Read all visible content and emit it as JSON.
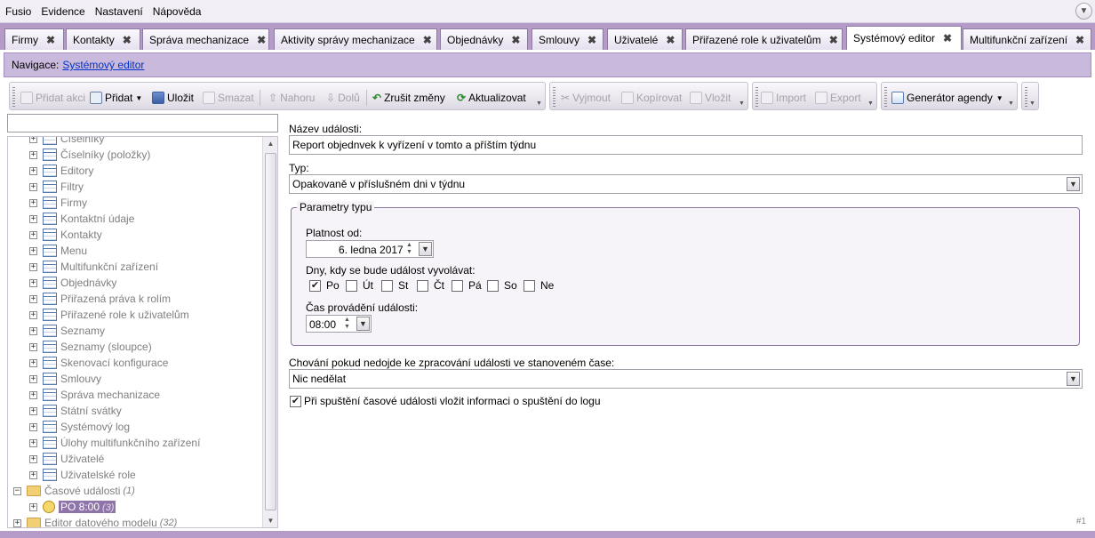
{
  "menu": [
    "Fusio",
    "Evidence",
    "Nastavení",
    "Nápověda"
  ],
  "tabs": [
    {
      "label": "Firmy",
      "active": false
    },
    {
      "label": "Kontakty",
      "active": false
    },
    {
      "label": "Správa mechanizace",
      "active": false
    },
    {
      "label": "Aktivity správy mechanizace",
      "active": false
    },
    {
      "label": "Objednávky",
      "active": false
    },
    {
      "label": "Smlouvy",
      "active": false
    },
    {
      "label": "Uživatelé",
      "active": false
    },
    {
      "label": "Přiřazené role k uživatelům",
      "active": false
    },
    {
      "label": "Systémový editor",
      "active": true
    },
    {
      "label": "Multifunkční zařízení",
      "active": false
    }
  ],
  "tab_close": "✖",
  "navigation": {
    "label": "Navigace:",
    "link": "Systémový editor"
  },
  "toolbar": {
    "add_action": "Přidat akci",
    "add": "Přidat",
    "save": "Uložit",
    "delete": "Smazat",
    "up": "Nahoru",
    "down": "Dolů",
    "cancel_changes": "Zrušit změny",
    "refresh": "Aktualizovat",
    "cut": "Vyjmout",
    "copy": "Kopírovat",
    "paste": "Vložit",
    "import": "Import",
    "export": "Export",
    "agenda_generator": "Generátor agendy"
  },
  "tree": {
    "items": [
      {
        "label": "Číselníky",
        "partial": true
      },
      {
        "label": "Číselníky (položky)"
      },
      {
        "label": "Editory"
      },
      {
        "label": "Filtry"
      },
      {
        "label": "Firmy"
      },
      {
        "label": "Kontaktní údaje"
      },
      {
        "label": "Kontakty"
      },
      {
        "label": "Menu"
      },
      {
        "label": "Multifunkční zařízení"
      },
      {
        "label": "Objednávky"
      },
      {
        "label": "Přiřazená práva k rolím"
      },
      {
        "label": "Přiřazené role k uživatelům"
      },
      {
        "label": "Seznamy"
      },
      {
        "label": "Seznamy (sloupce)"
      },
      {
        "label": "Skenovací konfigurace"
      },
      {
        "label": "Smlouvy"
      },
      {
        "label": "Správa mechanizace"
      },
      {
        "label": "Státní svátky"
      },
      {
        "label": "Systémový log"
      },
      {
        "label": "Úlohy multifunkčního zařízení"
      },
      {
        "label": "Uživatelé"
      },
      {
        "label": "Uživatelské role"
      }
    ],
    "events_folder": {
      "label": "Časové události",
      "count": "(1)"
    },
    "event_item": {
      "label": "PO 8:00",
      "count": "(3)"
    },
    "model_folder": {
      "label": "Editor datového modelu",
      "count": "(32)"
    }
  },
  "form": {
    "event_name_label": "Název události:",
    "event_name_value": "Report objednvek k vyřízení v tomto a příštím týdnu",
    "type_label": "Typ:",
    "type_value": "Opakovaně v příslušném dni v týdnu",
    "params_title": "Parametry typu",
    "valid_from_label": "Platnost od:",
    "valid_from_value": "6. ledna 2017",
    "days_label": "Dny, kdy se bude událost vyvolávat:",
    "days": [
      {
        "label": "Po",
        "checked": true
      },
      {
        "label": "Út",
        "checked": false
      },
      {
        "label": "St",
        "checked": false
      },
      {
        "label": "Čt",
        "checked": false
      },
      {
        "label": "Pá",
        "checked": false
      },
      {
        "label": "So",
        "checked": false
      },
      {
        "label": "Ne",
        "checked": false
      }
    ],
    "time_label": "Čas provádění události:",
    "time_value": "08:00",
    "behavior_label": "Chování pokud nedojde ke zpracování události ve stanoveném čase:",
    "behavior_value": "Nic nedělat",
    "log_checkbox_label": "Při spuštění časové události vložit informaci o spuštění do logu",
    "log_checked": true
  },
  "status_text": "#1",
  "colors": {
    "accent": "#b49bc8",
    "nav_bg": "#c9b9dc",
    "selection": "#8e74a9",
    "link": "#0033cc"
  }
}
